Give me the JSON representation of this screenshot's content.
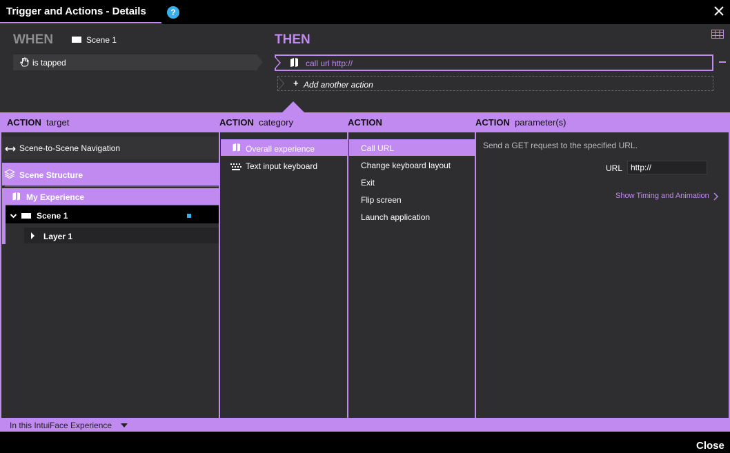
{
  "window": {
    "title": "Trigger and Actions - Details",
    "help_label": "?",
    "close_label": "Close"
  },
  "when": {
    "label": "WHEN",
    "source": "Scene 1",
    "trigger": "is tapped"
  },
  "then": {
    "label": "THEN",
    "action": "call url http://",
    "add_plus": "+",
    "add_action": "Add another action"
  },
  "columns": {
    "target": {
      "bold": "ACTION",
      "rest": "target"
    },
    "category": {
      "bold": "ACTION",
      "rest": "category"
    },
    "action": {
      "bold": "ACTION",
      "rest": ""
    },
    "parameters": {
      "bold": "ACTION",
      "rest": "parameter(s)"
    }
  },
  "targets": {
    "navigation": "Scene-to-Scene Navigation",
    "structure": "Scene Structure",
    "experience": "My Experience",
    "scene": "Scene 1",
    "layer": "Layer 1"
  },
  "categories": [
    {
      "label": "Overall experience",
      "icon": "experience-icon",
      "selected": true
    },
    {
      "label": "Text input keyboard",
      "icon": "keyboard-icon",
      "selected": false
    }
  ],
  "actions": [
    {
      "label": "Call URL",
      "selected": true
    },
    {
      "label": "Change keyboard layout",
      "selected": false
    },
    {
      "label": "Exit",
      "selected": false
    },
    {
      "label": "Flip screen",
      "selected": false
    },
    {
      "label": "Launch application",
      "selected": false
    }
  ],
  "parameters": {
    "description": "Send a GET request to the specified URL.",
    "url_label": "URL",
    "url_value": "http://",
    "timing_link": "Show Timing and Animation"
  },
  "footer": {
    "scope": "In this IntuiFace Experience"
  },
  "colors": {
    "accent": "#c08af0",
    "panel": "#2e2e30",
    "highlight_blue": "#3ab0ea"
  }
}
